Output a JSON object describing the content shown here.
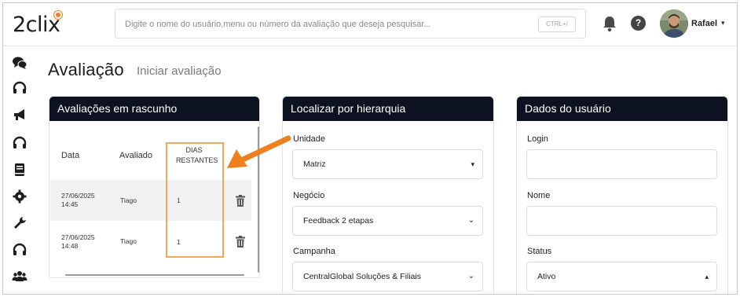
{
  "app": {
    "logo_text": "2clix",
    "brand_color": "#f0801f",
    "header_dark": "#0d1220"
  },
  "search": {
    "placeholder": "Digite o nome do usuário,menu ou número da avaliação que deseja pesquisar...",
    "shortcut": "CTRL+/"
  },
  "header": {
    "bell_icon": "bell-icon",
    "help_label": "?",
    "user_name": "Rafael",
    "user_caret": "▾"
  },
  "sidebar": {
    "items": [
      {
        "icon": "chat-icon"
      },
      {
        "icon": "headset-icon"
      },
      {
        "icon": "megaphone-icon"
      },
      {
        "icon": "headset-icon"
      },
      {
        "icon": "book-icon"
      },
      {
        "icon": "gear-icon"
      },
      {
        "icon": "wrench-icon"
      },
      {
        "icon": "headset-icon"
      },
      {
        "icon": "users-icon"
      }
    ]
  },
  "page": {
    "title": "Avaliação",
    "subtitle": "Iniciar avaliação"
  },
  "rascunho": {
    "header": "Avaliações em rascunho",
    "columns": [
      "Data",
      "Avaliado",
      "DIAS\nRESTANTES"
    ],
    "col_data": "Data",
    "col_avaliado": "Avaliado",
    "col_dias_1": "DIAS",
    "col_dias_2": "RESTANTES",
    "rows": [
      {
        "date": "27/06/2025",
        "time": "14:45",
        "avaliado": "Tiago",
        "dias": "1"
      },
      {
        "date": "27/06/2025",
        "time": "14:48",
        "avaliado": "Tiago",
        "dias": "1"
      }
    ]
  },
  "hierarquia": {
    "header": "Localizar por hierarquia",
    "unidade_label": "Unidade",
    "unidade_value": "Matriz",
    "negocio_label": "Negócio",
    "negocio_value": "Feedback 2 etapas",
    "campanha_label": "Campanha",
    "campanha_value": "CentralGlobal Soluções & Filiais"
  },
  "usuario": {
    "header": "Dados do usuário",
    "login_label": "Login",
    "login_value": "",
    "nome_label": "Nome",
    "nome_value": "",
    "status_label": "Status",
    "status_value": "Ativo"
  },
  "annotation": {
    "color": "#f2a65a",
    "arrow_color": "#f0801f"
  }
}
